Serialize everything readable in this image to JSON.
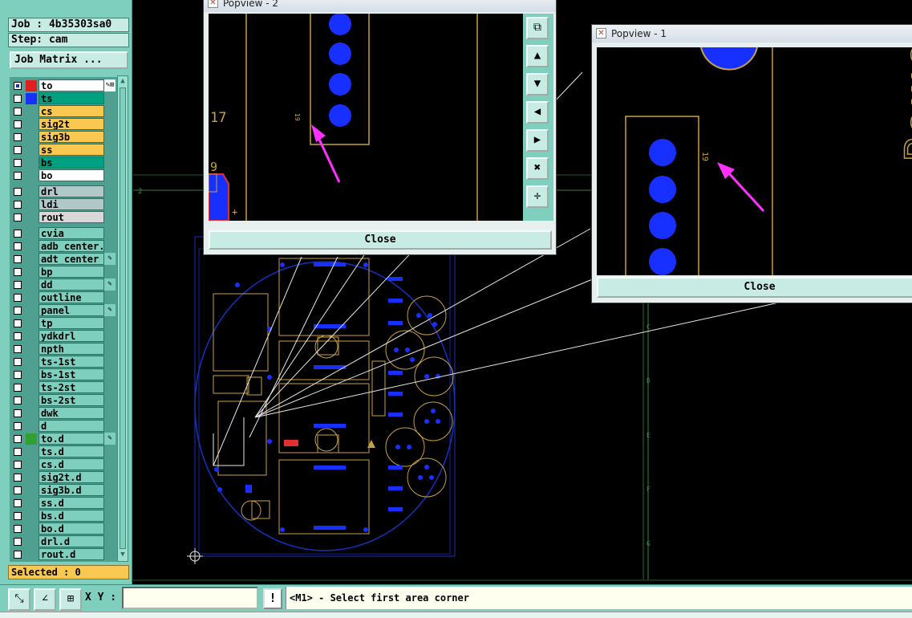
{
  "job": {
    "label": "Job : 4b35303sa0",
    "step": "Step: cam"
  },
  "job_matrix_label": "Job Matrix ...",
  "colors": {
    "panel": "#7fcfbf",
    "copper": "#c8a040",
    "pad": "#0018ff",
    "arrow": "#ff30ff",
    "outline": "#1830c0",
    "green": "#00a080",
    "yellow": "#f8c850"
  },
  "layers": [
    {
      "name": "to",
      "bg": "#ffffff",
      "swatch": "#e02020",
      "checked": true,
      "flag": "✎⊞"
    },
    {
      "name": "ts",
      "bg": "#00a080",
      "swatch": "#1830ff",
      "checked": false,
      "flag": ""
    },
    {
      "name": "cs",
      "bg": "#f8c850",
      "swatch": "",
      "checked": false,
      "flag": ""
    },
    {
      "name": "sig2t",
      "bg": "#f8c850",
      "swatch": "",
      "checked": false,
      "flag": ""
    },
    {
      "name": "sig3b",
      "bg": "#f8c850",
      "swatch": "",
      "checked": false,
      "flag": ""
    },
    {
      "name": "ss",
      "bg": "#f8c850",
      "swatch": "",
      "checked": false,
      "flag": ""
    },
    {
      "name": "bs",
      "bg": "#00a080",
      "swatch": "",
      "checked": false,
      "flag": ""
    },
    {
      "name": "bo",
      "bg": "#ffffff",
      "swatch": "",
      "checked": false,
      "flag": ""
    },
    {
      "name": "drl",
      "bg": "#b0c8c8",
      "swatch": "",
      "checked": false,
      "flag": "",
      "gap": true
    },
    {
      "name": "ldi",
      "bg": "#b0c8c8",
      "swatch": "",
      "checked": false,
      "flag": ""
    },
    {
      "name": "rout",
      "bg": "#d8d8d8",
      "swatch": "",
      "checked": false,
      "flag": ""
    },
    {
      "name": "cvia",
      "bg": "#7fcfbf",
      "swatch": "",
      "checked": false,
      "flag": "",
      "gap": true
    },
    {
      "name": "adb_center.",
      "bg": "#7fcfbf",
      "swatch": "",
      "checked": false,
      "flag": ""
    },
    {
      "name": "adt_center",
      "bg": "#7fcfbf",
      "swatch": "",
      "checked": false,
      "flag": "✎"
    },
    {
      "name": "bp",
      "bg": "#7fcfbf",
      "swatch": "",
      "checked": false,
      "flag": ""
    },
    {
      "name": "dd",
      "bg": "#7fcfbf",
      "swatch": "",
      "checked": false,
      "flag": "✎"
    },
    {
      "name": "outline",
      "bg": "#7fcfbf",
      "swatch": "",
      "checked": false,
      "flag": ""
    },
    {
      "name": "panel",
      "bg": "#7fcfbf",
      "swatch": "",
      "checked": false,
      "flag": "✎"
    },
    {
      "name": "tp",
      "bg": "#7fcfbf",
      "swatch": "",
      "checked": false,
      "flag": ""
    },
    {
      "name": "ydkdrl",
      "bg": "#7fcfbf",
      "swatch": "",
      "checked": false,
      "flag": ""
    },
    {
      "name": "npth",
      "bg": "#7fcfbf",
      "swatch": "",
      "checked": false,
      "flag": ""
    },
    {
      "name": "ts-1st",
      "bg": "#7fcfbf",
      "swatch": "",
      "checked": false,
      "flag": ""
    },
    {
      "name": "bs-1st",
      "bg": "#7fcfbf",
      "swatch": "",
      "checked": false,
      "flag": ""
    },
    {
      "name": "ts-2st",
      "bg": "#7fcfbf",
      "swatch": "",
      "checked": false,
      "flag": ""
    },
    {
      "name": "bs-2st",
      "bg": "#7fcfbf",
      "swatch": "",
      "checked": false,
      "flag": ""
    },
    {
      "name": "dwk",
      "bg": "#7fcfbf",
      "swatch": "",
      "checked": false,
      "flag": ""
    },
    {
      "name": "d",
      "bg": "#7fcfbf",
      "swatch": "",
      "checked": false,
      "flag": ""
    },
    {
      "name": "to.d",
      "bg": "#7fcfbf",
      "swatch": "#30a030",
      "checked": false,
      "flag": "✎"
    },
    {
      "name": "ts.d",
      "bg": "#7fcfbf",
      "swatch": "",
      "checked": false,
      "flag": ""
    },
    {
      "name": "cs.d",
      "bg": "#7fcfbf",
      "swatch": "",
      "checked": false,
      "flag": ""
    },
    {
      "name": "sig2t.d",
      "bg": "#7fcfbf",
      "swatch": "",
      "checked": false,
      "flag": ""
    },
    {
      "name": "sig3b.d",
      "bg": "#7fcfbf",
      "swatch": "",
      "checked": false,
      "flag": ""
    },
    {
      "name": "ss.d",
      "bg": "#7fcfbf",
      "swatch": "",
      "checked": false,
      "flag": ""
    },
    {
      "name": "bs.d",
      "bg": "#7fcfbf",
      "swatch": "",
      "checked": false,
      "flag": ""
    },
    {
      "name": "bo.d",
      "bg": "#7fcfbf",
      "swatch": "",
      "checked": false,
      "flag": ""
    },
    {
      "name": "drl.d",
      "bg": "#7fcfbf",
      "swatch": "",
      "checked": false,
      "flag": ""
    },
    {
      "name": "rout.d",
      "bg": "#7fcfbf",
      "swatch": "",
      "checked": false,
      "flag": ""
    }
  ],
  "selected_label": "Selected : 0",
  "popview2": {
    "title": "Popview - 2",
    "close_label": "Close",
    "texts": {
      "num17": "17",
      "num9": "9",
      "ref19": "19",
      "plus": "+"
    },
    "tools": [
      "⧉",
      "▲",
      "▼",
      "◀",
      "▶",
      "✖",
      "✛"
    ]
  },
  "popview1": {
    "title": "Popview - 1",
    "close_label": "Close",
    "texts": {
      "ref19": "19",
      "power": "Powe"
    }
  },
  "grid_letters": [
    "C",
    "D",
    "E",
    "F",
    "G"
  ],
  "ruler_number": "2",
  "bottom": {
    "xy_label": "X Y :",
    "xy_value": "",
    "excl": "!",
    "status": "<M1> - Select first area corner"
  }
}
